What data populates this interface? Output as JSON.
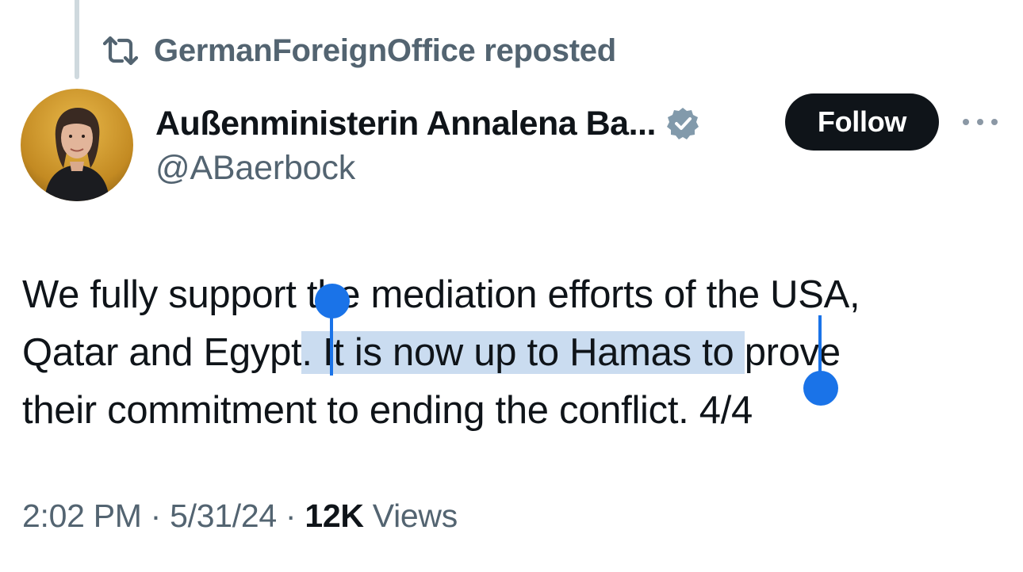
{
  "repost": {
    "icon": "repost-icon",
    "text": "GermanForeignOffice reposted"
  },
  "author": {
    "avatar": "avatar",
    "display_name": "Außenministerin Annalena Ba...",
    "verified_icon": "verified-badge-icon",
    "verified_color": "#829aab",
    "handle": "@ABaerbock"
  },
  "actions": {
    "follow_label": "Follow",
    "more_icon": "more-options-icon"
  },
  "tweet": {
    "line1": "We fully support the mediation efforts of the USA,",
    "line2_before": "Qatar and Egypt",
    "line2_selected": ". It is now up to Hamas to ",
    "line2_after": "prove",
    "line3": "their commitment to ending the conflict. 4/4",
    "selection_color": "#cadcf0",
    "selection_handle_color": "#1a73e8"
  },
  "meta": {
    "time": "2:02 PM",
    "separator": " · ",
    "date": "5/31/24",
    "views_count": "12K",
    "views_label": " Views"
  }
}
